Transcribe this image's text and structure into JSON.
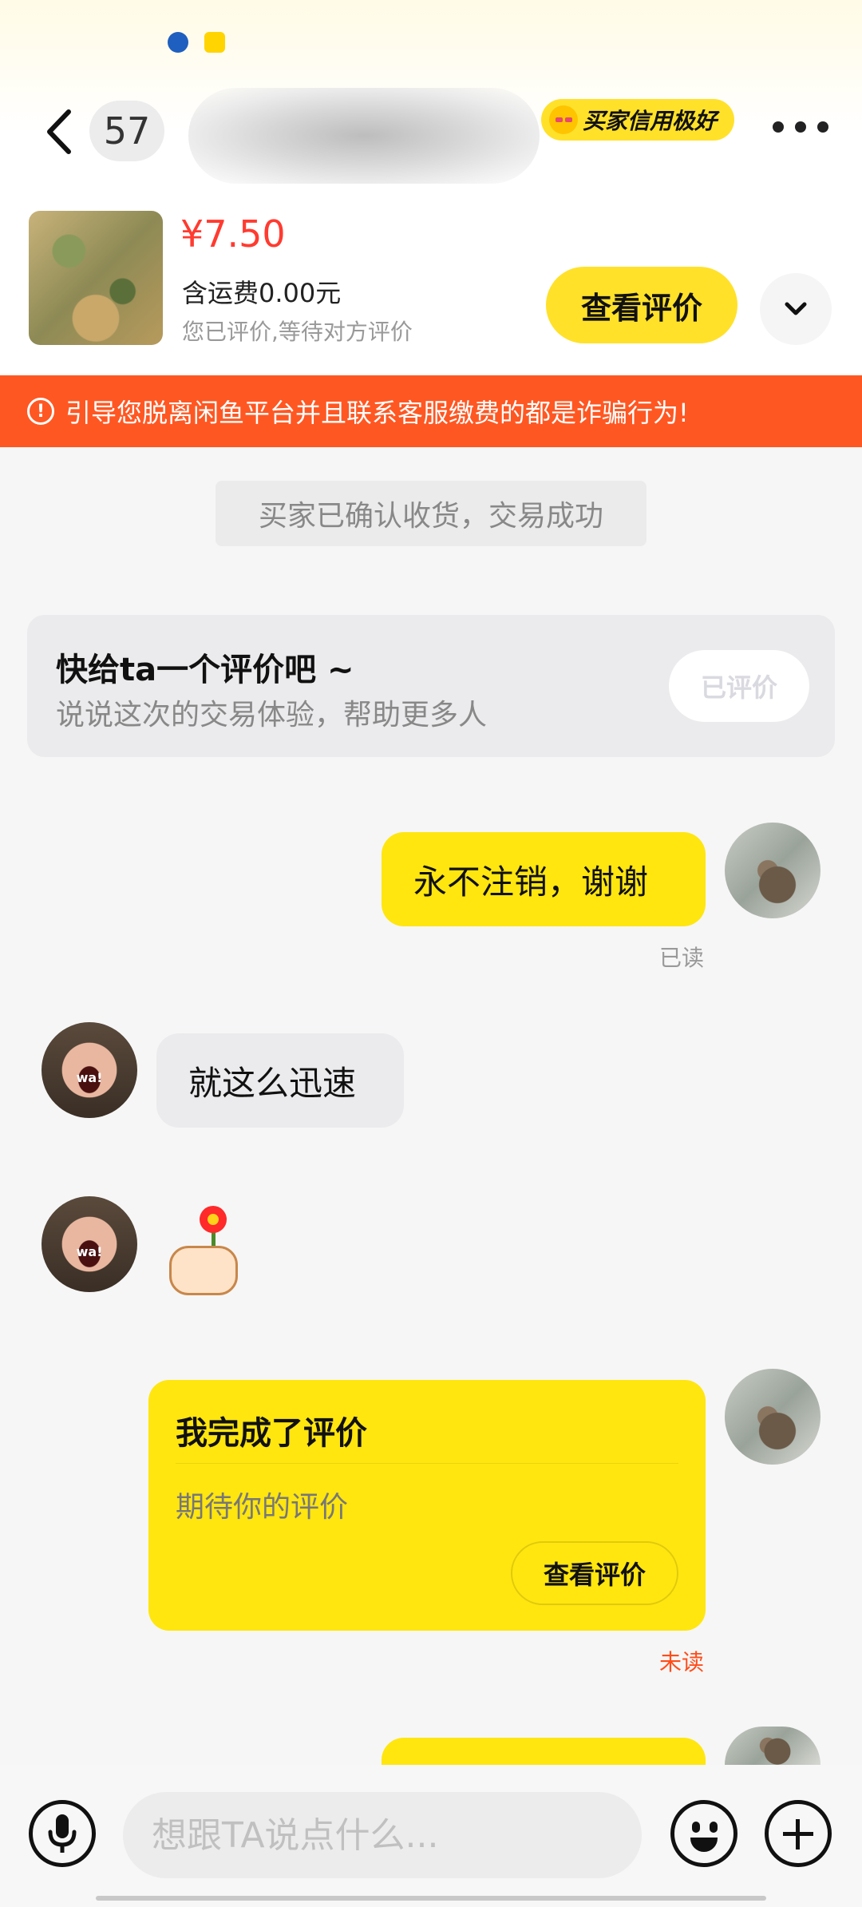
{
  "header": {
    "unread_count": "57",
    "credit_badge": "买家信用极好"
  },
  "product": {
    "price": "¥7.50",
    "shipping": "含运费0.00元",
    "status": "您已评价,等待对方评价",
    "view_review_label": "查看评价"
  },
  "warning": {
    "text": "引导您脱离闲鱼平台并且联系客服缴费的都是诈骗行为!"
  },
  "chat": {
    "system_notice": "买家已确认收货，交易成功",
    "review_prompt": {
      "title": "快给ta一个评价吧 ~",
      "subtitle": "说说这次的交易体验，帮助更多人",
      "button_label": "已评价"
    },
    "messages": [
      {
        "sender": "me",
        "text": "永不注销，谢谢",
        "status": "已读"
      },
      {
        "sender": "other",
        "text": "就这么迅速"
      },
      {
        "sender": "other",
        "sticker": "thumb-with-flower"
      }
    ],
    "review_card": {
      "title": "我完成了评价",
      "subtitle": "期待你的评价",
      "button_label": "查看评价",
      "status": "未读"
    },
    "avatar_caption": "wa!"
  },
  "input": {
    "placeholder": "想跟TA说点什么..."
  },
  "colors": {
    "accent_yellow": "#ffe60f",
    "warning_orange": "#ff5722",
    "price_red": "#ff3b30",
    "unread_red": "#ff4d1a"
  },
  "icons": [
    "back-chevron-icon",
    "more-icon",
    "chevron-down-icon",
    "alert-icon",
    "mic-icon",
    "emoji-icon",
    "plus-icon"
  ]
}
